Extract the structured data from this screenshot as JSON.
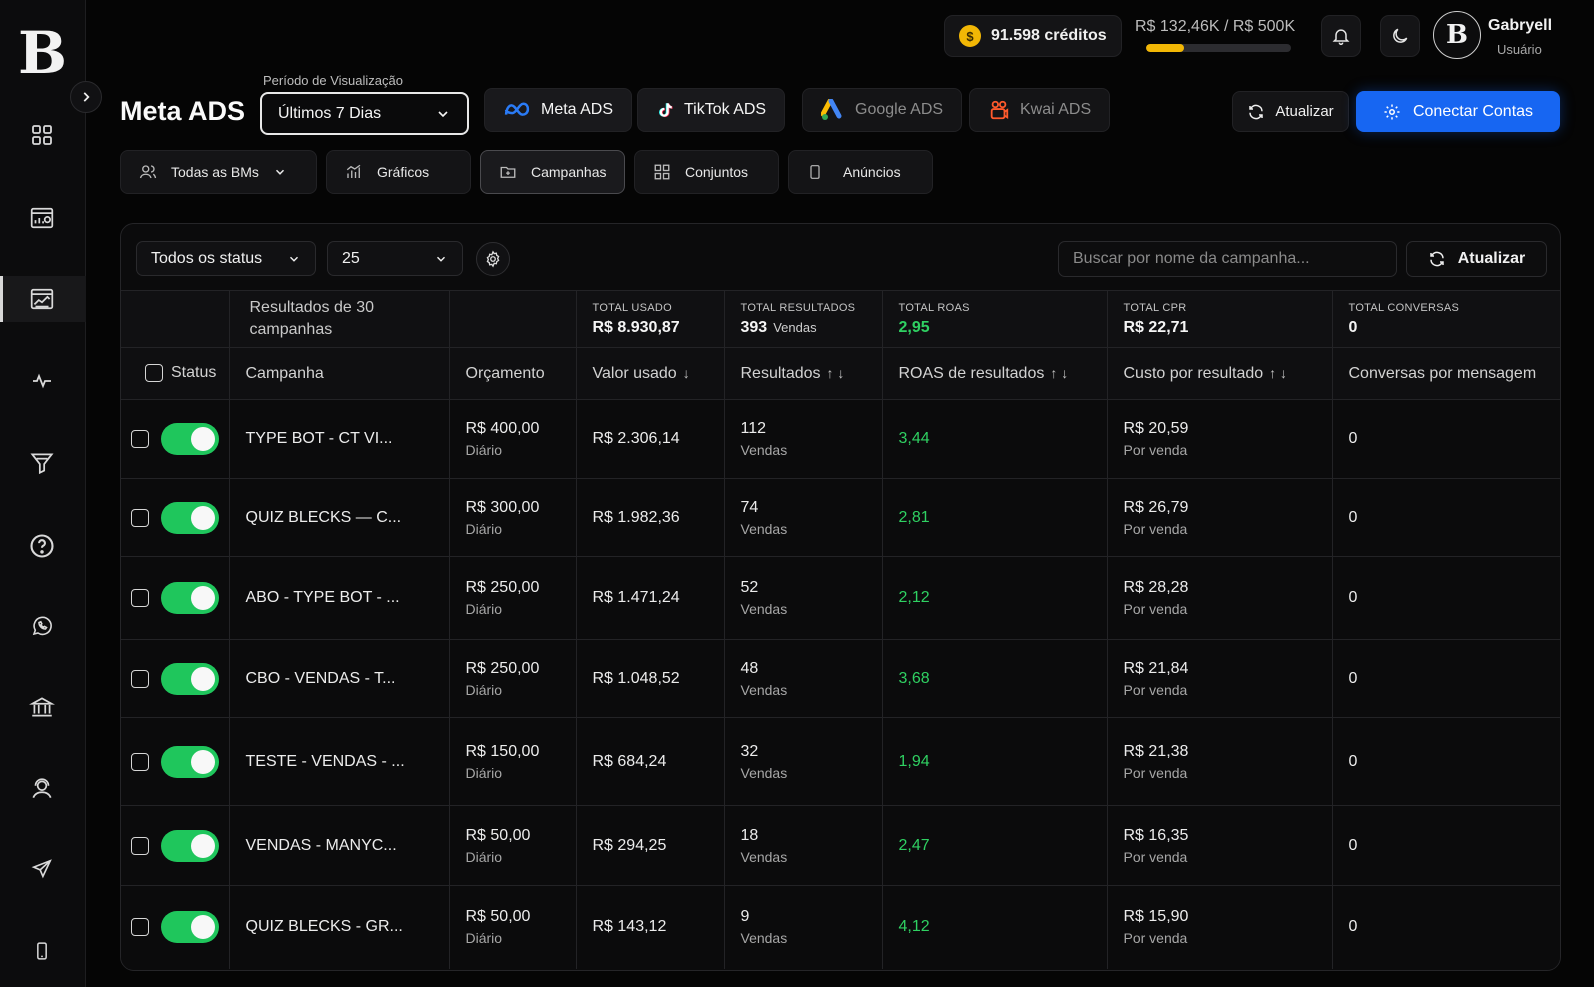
{
  "header": {
    "credits": "91.598 créditos",
    "coin_symbol": "$",
    "spend": "R$ 132,46K / R$ 500K",
    "spend_progress": 0.265,
    "user_name": "Gabryell",
    "user_role": "Usuário",
    "avatar_letter": "B"
  },
  "sidebar": {
    "logo": "B",
    "icons": [
      "dashboard-grid-icon",
      "report-chart-icon",
      "analytics-chart-icon",
      "activity-pulse-icon",
      "funnel-icon",
      "help-icon",
      "whatsapp-icon",
      "bank-icon",
      "user-support-icon",
      "send-icon",
      "mobile-icon"
    ],
    "active_index": 2
  },
  "page": {
    "title": "Meta ADS",
    "period_label": "Período de Visualização",
    "period_value": "Últimos 7 Dias"
  },
  "platforms": [
    {
      "label": "Meta ADS",
      "active": true
    },
    {
      "label": "TikTok ADS",
      "active": true
    },
    {
      "label": "Google ADS",
      "active": false
    },
    {
      "label": "Kwai ADS",
      "active": false
    }
  ],
  "actions": {
    "refresh_label": "Atualizar",
    "connect_label": "Conectar Contas"
  },
  "views": [
    {
      "label": "Todas as BMs"
    },
    {
      "label": "Gráficos"
    },
    {
      "label": "Campanhas"
    },
    {
      "label": "Conjuntos"
    },
    {
      "label": "Anúncios"
    }
  ],
  "toolbar": {
    "status_filter": "Todos os status",
    "page_size": "25",
    "search_placeholder": "Buscar por nome da campanha...",
    "refresh_label": "Atualizar"
  },
  "summary": {
    "results_of": "Resultados de 30 campanhas",
    "total_usado_label": "TOTAL USADO",
    "total_usado": "R$ 8.930,87",
    "total_resultados_label": "TOTAL RESULTADOS",
    "total_resultados": "393",
    "total_resultados_unit": "Vendas",
    "total_roas_label": "TOTAL ROAS",
    "total_roas": "2,95",
    "total_cpr_label": "TOTAL CPR",
    "total_cpr": "R$ 22,71",
    "total_conversas_label": "TOTAL CONVERSAS",
    "total_conversas": "0"
  },
  "columns": {
    "status": "Status",
    "campanha": "Campanha",
    "orcamento": "Orçamento",
    "valor_usado": "Valor usado",
    "resultados": "Resultados",
    "roas": "ROAS de resultados",
    "custo": "Custo por resultado",
    "conversas": "Conversas por mensagem",
    "sort_down": "↓",
    "sort_updown": "↑ ↓"
  },
  "rows": [
    {
      "name": "TYPE BOT - CT VI...",
      "budget": "R$ 400,00",
      "budget_type": "Diário",
      "spent": "R$ 2.306,14",
      "results": "112",
      "results_unit": "Vendas",
      "roas": "3,44",
      "cpr": "R$ 20,59",
      "cpr_unit": "Por venda",
      "conversas": "0"
    },
    {
      "name": "QUIZ BLECKS — C...",
      "budget": "R$ 300,00",
      "budget_type": "Diário",
      "spent": "R$ 1.982,36",
      "results": "74",
      "results_unit": "Vendas",
      "roas": "2,81",
      "cpr": "R$ 26,79",
      "cpr_unit": "Por venda",
      "conversas": "0"
    },
    {
      "name": "ABO - TYPE BOT - ...",
      "budget": "R$ 250,00",
      "budget_type": "Diário",
      "spent": "R$ 1.471,24",
      "results": "52",
      "results_unit": "Vendas",
      "roas": "2,12",
      "cpr": "R$ 28,28",
      "cpr_unit": "Por venda",
      "conversas": "0"
    },
    {
      "name": "CBO - VENDAS - T...",
      "budget": "R$ 250,00",
      "budget_type": "Diário",
      "spent": "R$ 1.048,52",
      "results": "48",
      "results_unit": "Vendas",
      "roas": "3,68",
      "cpr": "R$ 21,84",
      "cpr_unit": "Por venda",
      "conversas": "0"
    },
    {
      "name": "TESTE - VENDAS - ...",
      "budget": "R$ 150,00",
      "budget_type": "Diário",
      "spent": "R$ 684,24",
      "results": "32",
      "results_unit": "Vendas",
      "roas": "1,94",
      "cpr": "R$ 21,38",
      "cpr_unit": "Por venda",
      "conversas": "0"
    },
    {
      "name": "VENDAS - MANYC...",
      "budget": "R$ 50,00",
      "budget_type": "Diário",
      "spent": "R$ 294,25",
      "results": "18",
      "results_unit": "Vendas",
      "roas": "2,47",
      "cpr": "R$ 16,35",
      "cpr_unit": "Por venda",
      "conversas": "0"
    },
    {
      "name": "QUIZ BLECKS - GR...",
      "budget": "R$ 50,00",
      "budget_type": "Diário",
      "spent": "R$ 143,12",
      "results": "9",
      "results_unit": "Vendas",
      "roas": "4,12",
      "cpr": "R$ 15,90",
      "cpr_unit": "Por venda",
      "conversas": "0"
    }
  ],
  "colors": {
    "accent_blue": "#1766f2",
    "success_green": "#2fd162",
    "coin_yellow": "#f2b705"
  }
}
